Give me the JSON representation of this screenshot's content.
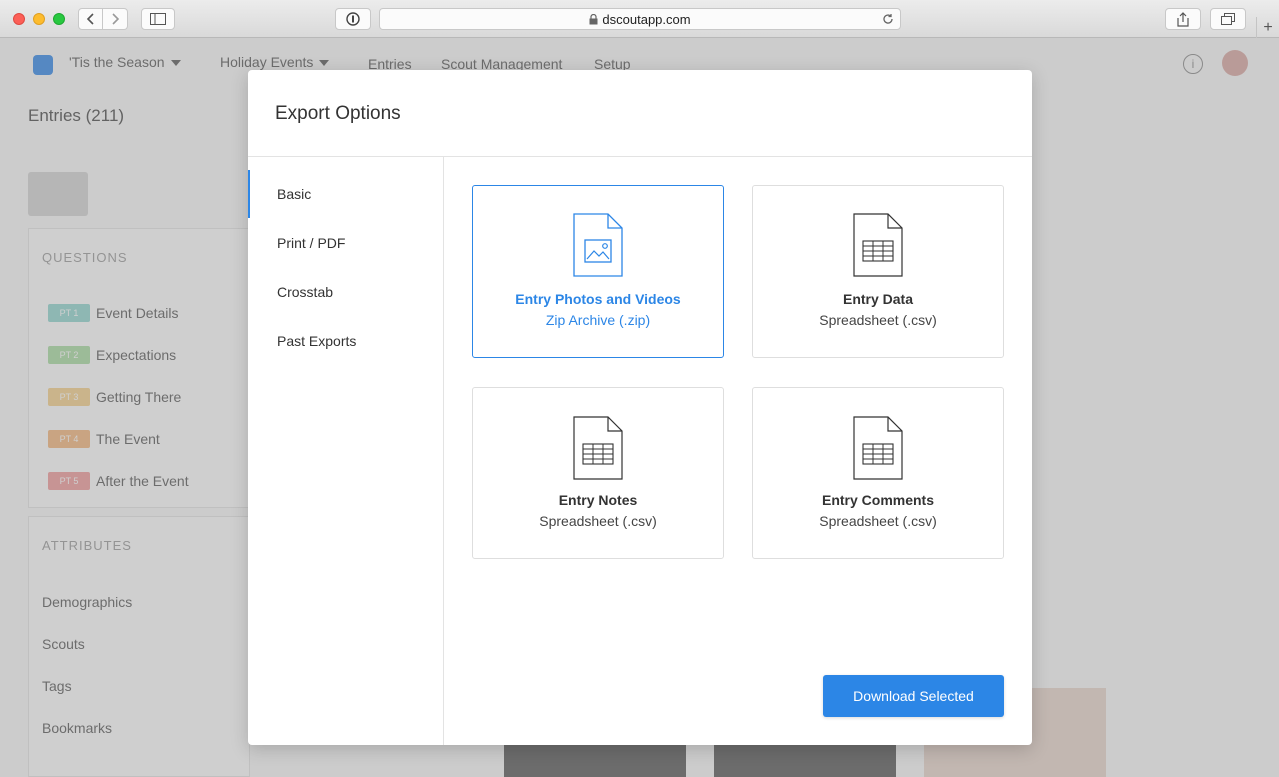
{
  "browser": {
    "url": "dscoutapp.com",
    "new_tab_glyph": "+",
    "nav_back_icon": "chevron-left-icon",
    "nav_forward_icon": "chevron-right-icon"
  },
  "background_page": {
    "project_menu": "'Tis the Season",
    "mission_menu": "Holiday Events",
    "nav": [
      "Entries",
      "Scout Management",
      "Setup"
    ],
    "page_title": "Entries (211)",
    "questions_label": "QUESTIONS",
    "questions": [
      {
        "badge": "PT 1",
        "label": "Event Details",
        "color": "#8fd6cf"
      },
      {
        "badge": "PT 2",
        "label": "Expectations",
        "color": "#a8dca0"
      },
      {
        "badge": "PT 3",
        "label": "Getting There",
        "color": "#f7d08a"
      },
      {
        "badge": "PT 4",
        "label": "The Event",
        "color": "#f5b67a"
      },
      {
        "badge": "PT 5",
        "label": "After the Event",
        "color": "#f19a9a"
      }
    ],
    "attributes_label": "ATTRIBUTES",
    "attributes": [
      "Demographics",
      "Scouts",
      "Tags",
      "Bookmarks"
    ],
    "help_glyph": "i"
  },
  "modal": {
    "title": "Export Options",
    "sidebar": [
      "Basic",
      "Print / PDF",
      "Crosstab",
      "Past Exports"
    ],
    "active_sidebar_index": 0,
    "cards": [
      {
        "title": "Entry Photos and Videos",
        "subtitle": "Zip Archive (.zip)",
        "icon": "image-file-icon",
        "selected": true
      },
      {
        "title": "Entry Data",
        "subtitle": "Spreadsheet (.csv)",
        "icon": "spreadsheet-file-icon",
        "selected": false
      },
      {
        "title": "Entry Notes",
        "subtitle": "Spreadsheet (.csv)",
        "icon": "spreadsheet-file-icon",
        "selected": false
      },
      {
        "title": "Entry Comments",
        "subtitle": "Spreadsheet (.csv)",
        "icon": "spreadsheet-file-icon",
        "selected": false
      }
    ],
    "download_label": "Download Selected",
    "accent_color": "#2c86e6"
  }
}
